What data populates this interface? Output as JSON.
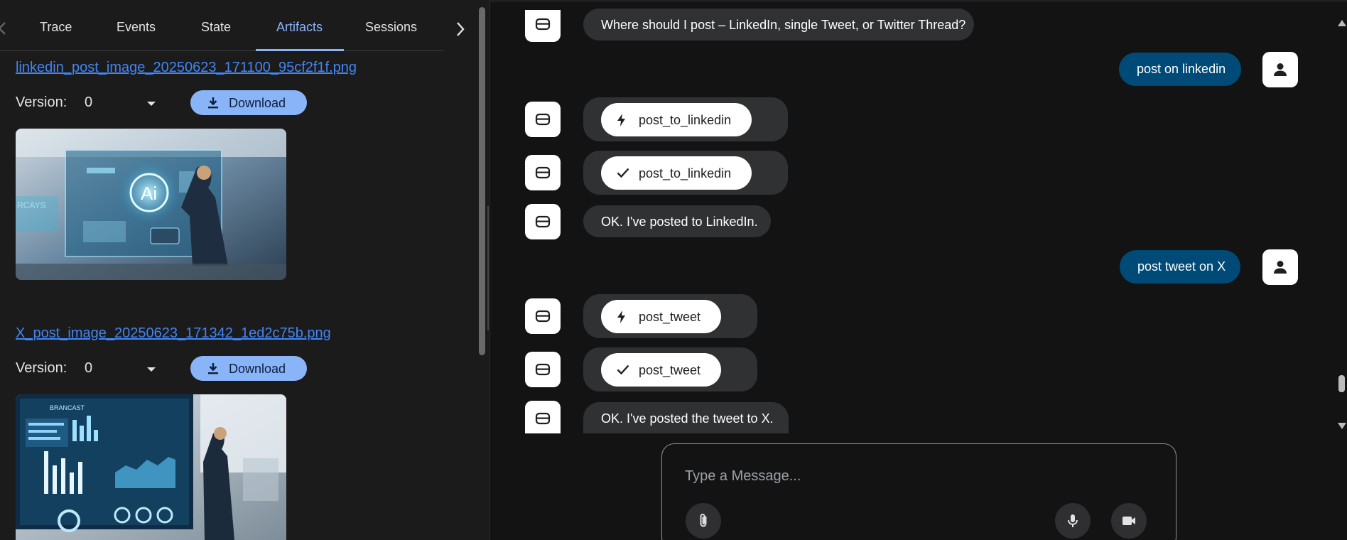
{
  "tabs": {
    "items": [
      "Trace",
      "Events",
      "State",
      "Artifacts",
      "Sessions"
    ],
    "active": "Artifacts"
  },
  "artifacts": [
    {
      "filename": "linkedin_post_image_20250623_171100_95cf2f1f.png",
      "version_label": "Version:",
      "version_value": "0",
      "download_label": "Download",
      "image_text": "Ai",
      "image_side_text": "RCAYS"
    },
    {
      "filename": "X_post_image_20250623_171342_1ed2c75b.png",
      "version_label": "Version:",
      "version_value": "0",
      "download_label": "Download",
      "image_text": "",
      "image_side_text": "BRANCAST"
    }
  ],
  "messages": [
    {
      "role": "bot",
      "kind": "text",
      "text": "Where should I post – LinkedIn, single Tweet, or Twitter Thread?"
    },
    {
      "role": "user",
      "kind": "text",
      "text": "post on linkedin"
    },
    {
      "role": "bot",
      "kind": "function_call",
      "text": "post_to_linkedin",
      "icon": "bolt-icon"
    },
    {
      "role": "bot",
      "kind": "function_response",
      "text": "post_to_linkedin",
      "icon": "check-icon"
    },
    {
      "role": "bot",
      "kind": "text",
      "text": "OK. I've posted to LinkedIn."
    },
    {
      "role": "user",
      "kind": "text",
      "text": "post tweet on X"
    },
    {
      "role": "bot",
      "kind": "function_call",
      "text": "post_tweet",
      "icon": "bolt-icon"
    },
    {
      "role": "bot",
      "kind": "function_response",
      "text": "post_tweet",
      "icon": "check-icon"
    },
    {
      "role": "bot",
      "kind": "text",
      "text": "OK. I've posted the tweet to X."
    }
  ],
  "composer": {
    "placeholder": "Type a Message...",
    "value": ""
  },
  "colors": {
    "accent": "#8ab4f8",
    "link": "#4285f4",
    "user_bubble": "#004a77",
    "bot_bubble": "#303133"
  },
  "icons": {
    "bot_avatar": "robot-icon",
    "user_avatar": "person-icon",
    "attach": "paperclip-icon",
    "mic": "microphone-icon",
    "video": "videocam-icon"
  }
}
